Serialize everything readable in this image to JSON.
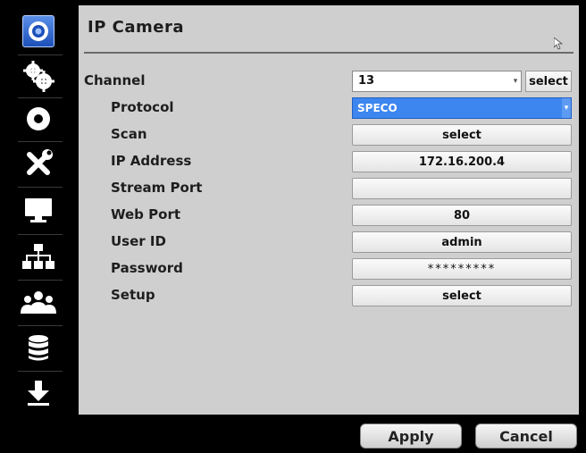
{
  "header": {
    "title": "IP Camera"
  },
  "sidebar": {
    "items": [
      {
        "icon": "camera-icon",
        "active": true
      },
      {
        "icon": "gears-icon"
      },
      {
        "icon": "disc-icon"
      },
      {
        "icon": "tools-icon"
      },
      {
        "icon": "monitor-icon"
      },
      {
        "icon": "network-icon"
      },
      {
        "icon": "users-icon"
      },
      {
        "icon": "database-icon"
      },
      {
        "icon": "download-icon"
      }
    ]
  },
  "form": {
    "channel": {
      "label": "Channel",
      "value": "13",
      "select_label": "select"
    },
    "protocol": {
      "label": "Protocol",
      "value": "SPECO"
    },
    "scan": {
      "label": "Scan",
      "value": "select"
    },
    "ip_address": {
      "label": "IP Address",
      "value": "172.16.200.4"
    },
    "stream_port": {
      "label": "Stream Port",
      "value": ""
    },
    "web_port": {
      "label": "Web Port",
      "value": "80"
    },
    "user_id": {
      "label": "User ID",
      "value": "admin"
    },
    "password": {
      "label": "Password",
      "value": "*********"
    },
    "setup": {
      "label": "Setup",
      "value": "select"
    }
  },
  "footer": {
    "apply_label": "Apply",
    "cancel_label": "Cancel"
  },
  "colors": {
    "accent": "#3d86f0",
    "panel": "#cfcfcf",
    "background": "#000000"
  }
}
